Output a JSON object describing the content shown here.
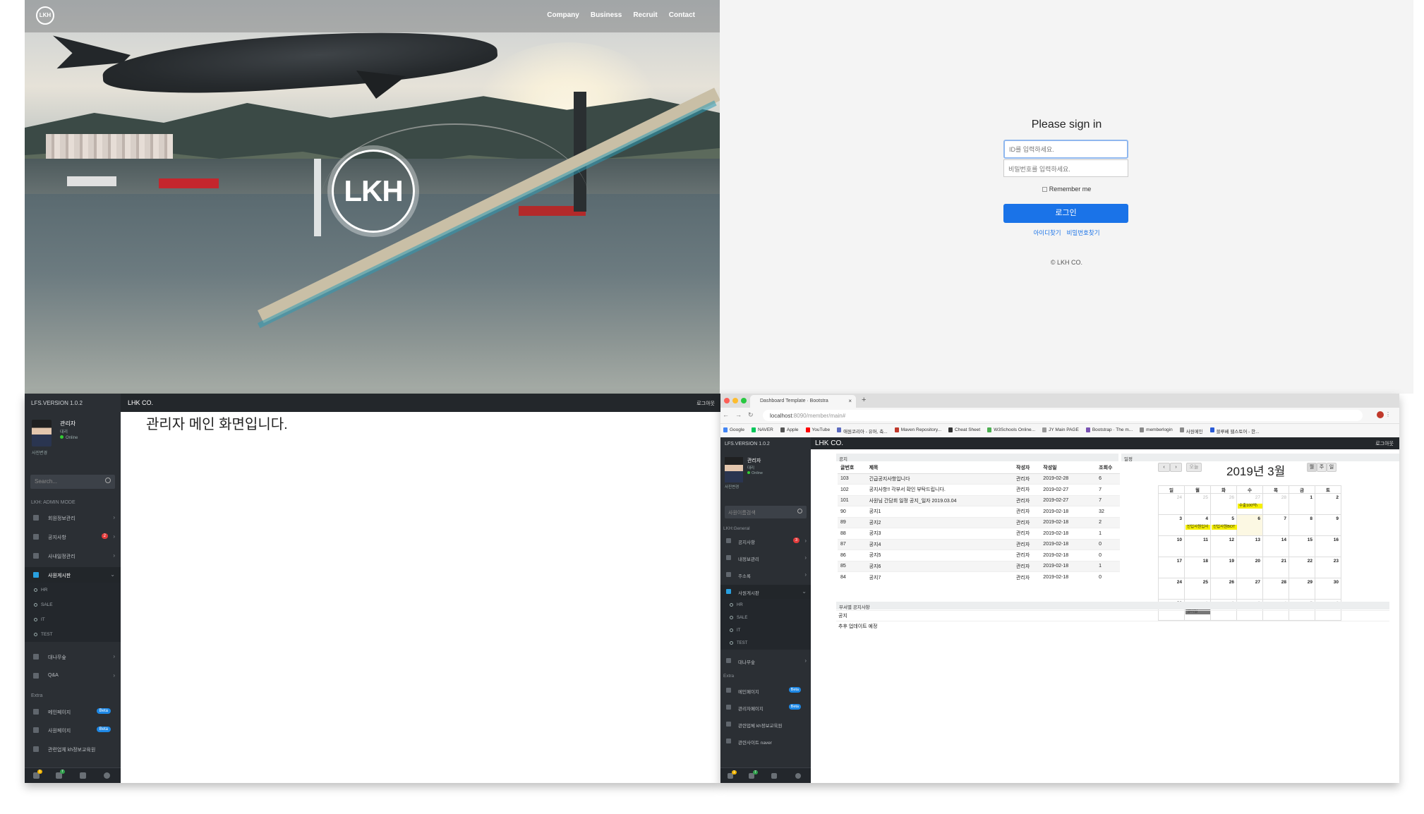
{
  "hero": {
    "logo_small": "LKH",
    "nav": [
      "Company",
      "Business",
      "Recruit",
      "Contact"
    ],
    "logo_big": "LKH"
  },
  "signin": {
    "title": "Please sign in",
    "id_placeholder": "ID를 입력하세요.",
    "pw_placeholder": "비밀번호를 입력하세요.",
    "remember": "Remember me",
    "button": "로그인",
    "find_id": "아이디찾기",
    "find_pw": "비밀번호찾기",
    "copyright": "© LKH CO."
  },
  "admin": {
    "version": "LFS.VERSION 1.0.2",
    "brand": "LHK CO.",
    "logout": "로그아웃",
    "message": "관리자 메인 화면입니다.",
    "user": {
      "name": "관리자",
      "role": "대리",
      "status": "Online",
      "change": "사진변경"
    },
    "search": "Search...",
    "section1": "LKH: ADMIN MODE",
    "items": [
      {
        "label": "회원정보관리"
      },
      {
        "label": "공지사항",
        "badge": "2"
      },
      {
        "label": "사내일정관리"
      },
      {
        "label": "사원게시판"
      }
    ],
    "sub": [
      "HR",
      "SALE",
      "IT",
      "TEST"
    ],
    "items2": [
      {
        "label": "대나무숲"
      },
      {
        "label": "Q&A"
      }
    ],
    "section2": "Extra",
    "extra": [
      {
        "label": "메인페이지",
        "badge": "Beta"
      },
      {
        "label": "사원페이지",
        "badge": "Beta"
      },
      {
        "label": "관련업체 kh정보교육원"
      }
    ],
    "foot": [
      "1",
      "7"
    ]
  },
  "dash": {
    "tab": "Dashboard Template · Bootstra",
    "url_host": "localhost",
    "url_path": ":8090/member/main#",
    "bookmarks": [
      "Google",
      "NAVER",
      "Apple",
      "YouTube",
      "애원코리아 - 유머, 축...",
      "Maven Repository...",
      "Cheat Sheet",
      "W3Schools Online...",
      "JY Main PAGE",
      "Bootstrap · The m...",
      "memberlogin",
      "사원메인",
      "블루베 웹스토어 - 한..."
    ],
    "version": "LFS.VERSION 1.0.2",
    "brand": "LHK CO.",
    "logout": "로그아웃",
    "user": {
      "name": "관리자",
      "role": "대리",
      "status": "Online",
      "change": "사진변경"
    },
    "search": "사원이름검색",
    "section1": "LKH:General",
    "items": [
      {
        "label": "공지사항",
        "badge": "3"
      },
      {
        "label": "내정보관리"
      },
      {
        "label": "주소록"
      },
      {
        "label": "사원게시판"
      }
    ],
    "sub": [
      "HR",
      "SALE",
      "IT",
      "TEST"
    ],
    "items2": [
      {
        "label": "대나무숲"
      }
    ],
    "section2": "Extra",
    "extra": [
      {
        "label": "메인페이지",
        "badge": "Beta"
      },
      {
        "label": "관리자페이지",
        "badge": "Beta"
      },
      {
        "label": "관련업체 kh정보교육원"
      },
      {
        "label": "관련사이트 naver"
      }
    ],
    "foot": [
      "1",
      "7"
    ],
    "notice_title": "공지",
    "notice_headers": [
      "글번호",
      "제목",
      "작성자",
      "작성일",
      "조회수"
    ],
    "notices": [
      [
        "103",
        "긴급공지사항입니다",
        "관리자",
        "2019-02-28",
        "6"
      ],
      [
        "102",
        "공지사항!! 각부서 확인 부탁드립니다.",
        "관리자",
        "2019-02-27",
        "7"
      ],
      [
        "101",
        "사원님 간담회 일정 공지_일자 2019.03.04",
        "관리자",
        "2019-02-27",
        "7"
      ],
      [
        "90",
        "공지1",
        "관리자",
        "2019-02-18",
        "32"
      ],
      [
        "89",
        "공지2",
        "관리자",
        "2019-02-18",
        "2"
      ],
      [
        "88",
        "공지3",
        "관리자",
        "2019-02-18",
        "1"
      ],
      [
        "87",
        "공지4",
        "관리자",
        "2019-02-18",
        "0"
      ],
      [
        "86",
        "공지5",
        "관리자",
        "2019-02-18",
        "0"
      ],
      [
        "85",
        "공지6",
        "관리자",
        "2019-02-18",
        "1"
      ],
      [
        "84",
        "공지7",
        "관리자",
        "2019-02-18",
        "0"
      ]
    ],
    "schedule_title": "일정",
    "cal": {
      "title": "2019년 3월",
      "today": "오늘",
      "views": [
        "월",
        "주",
        "일"
      ],
      "weekdays": [
        "일",
        "월",
        "화",
        "수",
        "목",
        "금",
        "토"
      ],
      "weeks": [
        [
          "24",
          "25",
          "26",
          "27",
          "28",
          "1",
          "2"
        ],
        [
          "3",
          "4",
          "5",
          "6",
          "7",
          "8",
          "9"
        ],
        [
          "10",
          "11",
          "12",
          "13",
          "14",
          "15",
          "16"
        ],
        [
          "17",
          "18",
          "19",
          "20",
          "21",
          "22",
          "23"
        ],
        [
          "24",
          "25",
          "26",
          "27",
          "28",
          "29",
          "30"
        ],
        [
          "31",
          "1",
          "2",
          "3",
          "4",
          "5",
          "6"
        ]
      ],
      "events": [
        "수출100억\\",
        "신입사원입사",
        "신입사원BOT",
        "영어팀"
      ]
    },
    "dept_title": "부서별 공지사항",
    "dept_rows": [
      "공지",
      "추후 업데이트 예정"
    ]
  }
}
